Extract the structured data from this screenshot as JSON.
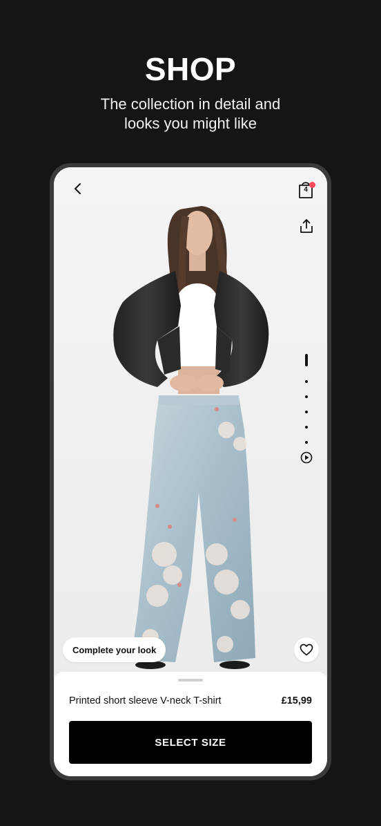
{
  "hero": {
    "title": "SHOP",
    "subtitle_line1": "The collection in detail and",
    "subtitle_line2": "looks you might like"
  },
  "topbar": {
    "back_icon": "chevron-left-icon",
    "cart_icon": "shopping-bag-icon",
    "cart_count": "4",
    "share_icon": "share-icon"
  },
  "gallery": {
    "image_count": 6,
    "active_index": 0,
    "has_video": true,
    "video_icon": "play-circle-icon"
  },
  "actions": {
    "complete_look_label": "Complete your look",
    "wishlist_icon": "heart-icon"
  },
  "product": {
    "name": "Printed short sleeve V-neck T-shirt",
    "price": "£15,99",
    "select_size_label": "SELECT SIZE"
  },
  "colors": {
    "background": "#161416",
    "cart_badge": "#ff4d5e",
    "button": "#000000"
  }
}
